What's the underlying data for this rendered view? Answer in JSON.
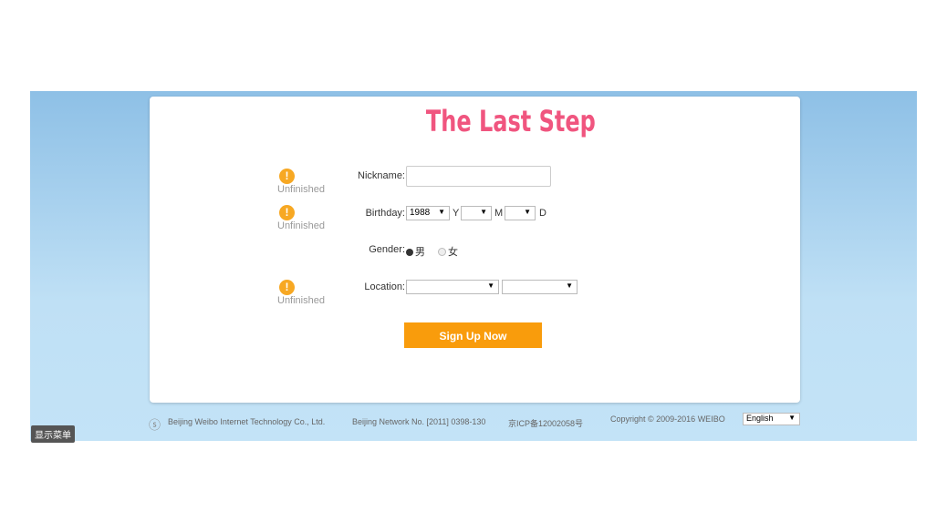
{
  "title": "The Last Step",
  "status_text": "Unfinished",
  "form": {
    "nickname_label": "Nickname:",
    "nickname_value": "",
    "birthday_label": "Birthday:",
    "year_value": "1988",
    "year_unit": "Y",
    "month_value": "",
    "month_unit": "M",
    "day_value": "",
    "day_unit": "D",
    "gender_label": "Gender:",
    "gender_options": [
      "男",
      "女"
    ],
    "gender_selected": "男",
    "location_label": "Location:",
    "province_value": "",
    "city_value": "",
    "submit_label": "Sign Up Now"
  },
  "footer": {
    "company": "Beijing Weibo Internet Technology Co., Ltd.",
    "network": "Beijing Network No. [2011] 0398-130",
    "icp": "京ICP备12002058号",
    "copyright": "Copyright © 2009-2016 WEIBO",
    "language": "English"
  },
  "menu_button": "显示菜单",
  "colors": {
    "accent": "#f99c0c",
    "title": "#f0557f",
    "warning": "#f7a823"
  }
}
